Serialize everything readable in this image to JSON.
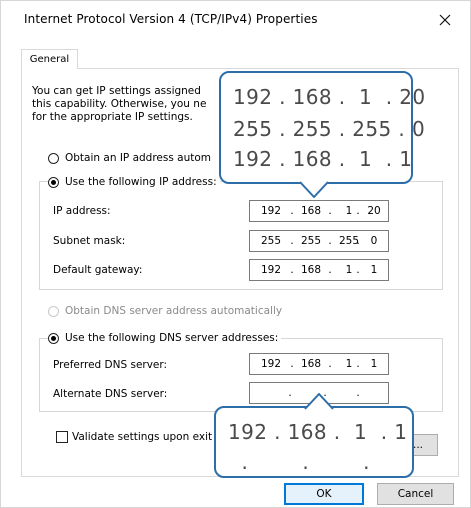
{
  "window": {
    "title": "Internet Protocol Version 4 (TCP/IPv4) Properties"
  },
  "tabs": [
    {
      "label": "General",
      "selected": true
    }
  ],
  "intro_text": "You can get IP settings assigned                                               rts\nthis capability. Otherwise, you ne                                            or\nfor the appropriate IP settings.",
  "ip_settings": {
    "obtain_automatic_label": "Obtain an IP address autom",
    "obtain_automatic_selected": false,
    "use_following_label": "Use the following IP address:",
    "use_following_selected": true,
    "fields": {
      "ip_address": {
        "label": "IP address:",
        "octets": [
          "192",
          "168",
          "1",
          "20"
        ]
      },
      "subnet_mask": {
        "label": "Subnet mask:",
        "octets": [
          "255",
          "255",
          "255",
          "0"
        ]
      },
      "default_gateway": {
        "label": "Default gateway:",
        "octets": [
          "192",
          "168",
          "1",
          "1"
        ]
      }
    }
  },
  "dns_settings": {
    "obtain_automatic_label": "Obtain DNS server address automatically",
    "obtain_automatic_selected": false,
    "obtain_automatic_disabled": true,
    "use_following_label": "Use the following DNS server addresses:",
    "use_following_selected": true,
    "fields": {
      "preferred_dns": {
        "label": "Preferred DNS server:",
        "octets": [
          "192",
          "168",
          "1",
          "1"
        ]
      },
      "alternate_dns": {
        "label": "Alternate DNS server:",
        "octets": [
          "",
          "",
          "",
          ""
        ]
      }
    }
  },
  "validate_settings": {
    "label": "Validate settings upon exit",
    "checked": false
  },
  "buttons": {
    "ok": "OK",
    "cancel": "Cancel",
    "advanced_visible": "..."
  },
  "callouts": {
    "top": {
      "lines": [
        "192 . 168 .  1  . 20",
        "255 . 255 . 255 . 0",
        "192 . 168 .  1  . 1"
      ]
    },
    "bottom": {
      "lines": [
        "192 . 168 .  1  . 1",
        "  .        .        ."
      ]
    }
  },
  "colors": {
    "callout_border": "#2d6ea8",
    "focus_border": "#0078d7"
  },
  "icons": {
    "close": "close-icon",
    "checkbox": "checkbox-icon",
    "radio": "radio-button-icon"
  }
}
